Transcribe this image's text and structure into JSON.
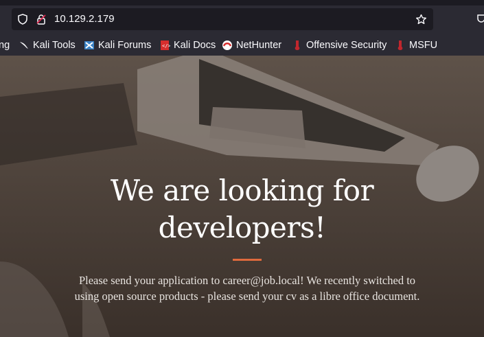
{
  "browser": {
    "url": "10.129.2.179",
    "bookmarks": [
      {
        "label": "ng",
        "icon": "partial-bookmark-icon"
      },
      {
        "label": "Kali Tools",
        "icon": "kali-dragon-icon"
      },
      {
        "label": "Kali Forums",
        "icon": "kali-forums-icon"
      },
      {
        "label": "Kali Docs",
        "icon": "kali-docs-icon"
      },
      {
        "label": "NetHunter",
        "icon": "nethunter-icon"
      },
      {
        "label": "Offensive Security",
        "icon": "offsec-icon"
      },
      {
        "label": "MSFU",
        "icon": "msfu-icon"
      }
    ]
  },
  "hero": {
    "title_line1": "We are looking for",
    "title_line2": "developers!",
    "subtitle_line1": "Please send your application to career@job.local! We recently switched to",
    "subtitle_line2": "using open source products - please send your cv as a libre office document."
  },
  "colors": {
    "accent": "#e06a3d",
    "chrome_bg": "#2b2a33",
    "urlbar_bg": "#1c1b22"
  }
}
